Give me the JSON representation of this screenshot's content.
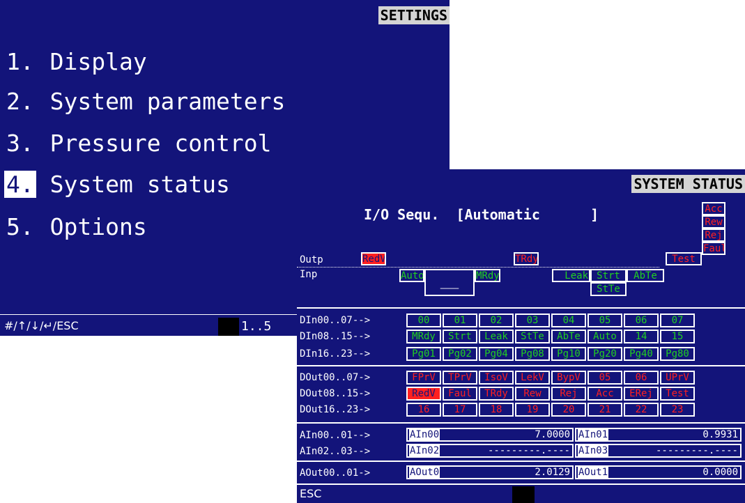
{
  "settings": {
    "title": "SETTINGS",
    "items": [
      {
        "num": "1.",
        "label": " Display"
      },
      {
        "num": "2.",
        "label": " System parameters"
      },
      {
        "num": "3.",
        "label": " Pressure control"
      },
      {
        "num": "4.",
        "label": " System status"
      },
      {
        "num": "5.",
        "label": " Options"
      }
    ],
    "selected_index": 3,
    "footer_keys": "#/↑/↓/↵/ESC",
    "page_range": "1..5"
  },
  "status": {
    "title": "SYSTEM STATUS",
    "mode_label": "I/O Sequ.",
    "mode_value": "[Automatic      ]",
    "outp_label": "Outp",
    "inp_label": "Inp",
    "outputs": [
      "RedV",
      "TRdy",
      "Test"
    ],
    "inputs": [
      "Auto",
      "__",
      "MRdy",
      "Leak",
      "Strt",
      "AbTe",
      "StTe"
    ],
    "alarms": [
      "Acc",
      "Rew",
      "Rej",
      "Faul"
    ],
    "din_rows": [
      {
        "label": "DIn00..07-->",
        "cells": [
          "00",
          "01",
          "02",
          "03",
          "04",
          "05",
          "06",
          "07"
        ]
      },
      {
        "label": "DIn08..15-->",
        "cells": [
          "MRdy",
          "Strt",
          "Leak",
          "StTe",
          "AbTe",
          "Auto",
          "14",
          "15"
        ]
      },
      {
        "label": "DIn16..23-->",
        "cells": [
          "Pg01",
          "Pg02",
          "Pg04",
          "Pg08",
          "Pg10",
          "Pg20",
          "Pg40",
          "Pg80"
        ]
      }
    ],
    "dout_rows": [
      {
        "label": "DOut00..07->",
        "cells": [
          "FPrV",
          "TPrV",
          "IsoV",
          "LekV",
          "BypV",
          "05",
          "06",
          "UPrV"
        ]
      },
      {
        "label": "DOut08..15->",
        "cells": [
          "RedV",
          "Faul",
          "TRdy",
          "Rew",
          "Rej",
          "Acc",
          "ERej",
          "Test"
        ]
      },
      {
        "label": "DOut16..23->",
        "cells": [
          "16",
          "17",
          "18",
          "19",
          "20",
          "21",
          "22",
          "23"
        ]
      }
    ],
    "ain_rows": [
      {
        "label": "AIn00..01-->",
        "a_tag": "AIn00",
        "a_val": "7.0000",
        "b_tag": "AIn01",
        "b_val": "0.9931"
      },
      {
        "label": "AIn02..03-->",
        "a_tag": "AIn02",
        "a_val": "---------.----",
        "b_tag": "AIn03",
        "b_val": "---------.----"
      }
    ],
    "aout_row": {
      "label": "AOut00..01->",
      "a_tag": "AOut0",
      "a_val": "2.0129",
      "b_tag": "AOut1",
      "b_val": "0.0000"
    },
    "footer_key": "ESC"
  },
  "colors": {
    "screen_bg": "#13147a",
    "active_green": "#21d021",
    "alarm_red": "#ff2020",
    "title_bg": "#d4d4d4"
  }
}
